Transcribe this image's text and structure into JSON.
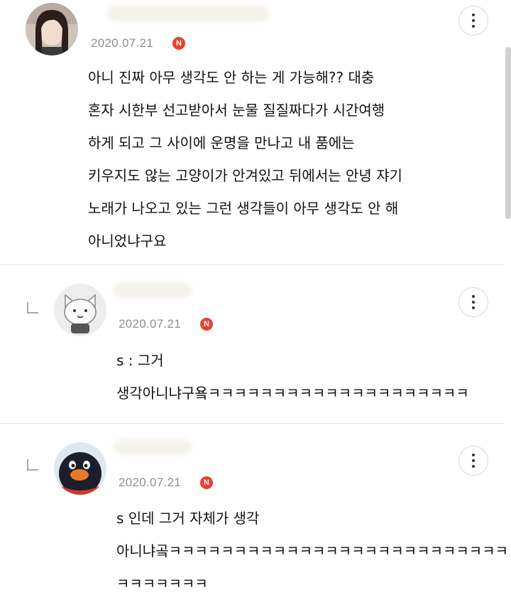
{
  "comments": [
    {
      "date": "2020.07.21",
      "badge": "N",
      "text": "아니 진짜 아무 생각도 안 하는 게 가능해?? 대충\n혼자 시한부 선고받아서 눈물 질질짜다가 시간여행\n하게 되고 그 사이에 운명을 만나고 내 품에는\n키우지도 않는 고양이가 안겨있고 뒤에서는 안녕 쟈기\n노래가 나오고 있는 그런 생각들이 아무 생각도 안 해\n아니었냐구요",
      "avatar_icon": "user-photo-avatar"
    },
    {
      "date": "2020.07.21",
      "badge": "N",
      "text": "s : 그거\n생각아니냐구욬ㅋㅋㅋㅋㅋㅋㅋㅋㅋㅋㅋㅋㅋㅋㅋㅋㅋㅋㅋㅋ",
      "avatar_icon": "cat-avatar"
    },
    {
      "date": "2020.07.21",
      "badge": "N",
      "text": "s 인데 그거 자체가 생각\n아니냐곸ㅋㅋㅋㅋㅋㅋㅋㅋㅋㅋㅋㅋㅋㅋㅋㅋㅋㅋㅋㅋㅋㅋㅋㅋㅋㅋ\nㅋㅋㅋㅋㅋㅋㅋ",
      "avatar_icon": "penguin-avatar"
    }
  ],
  "colors": {
    "badge": "#e8412e",
    "date": "#8f8f8f",
    "divider": "#e4e4e4"
  }
}
